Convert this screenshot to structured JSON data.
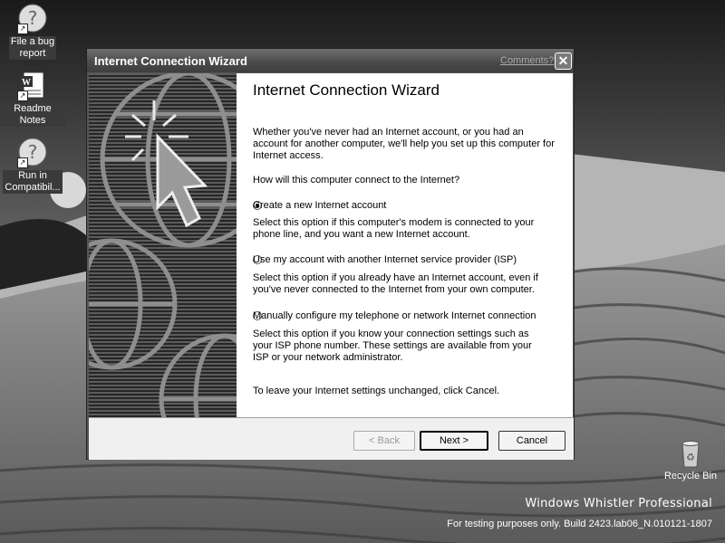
{
  "desktop": {
    "icons": [
      {
        "label_line1": "File a bug",
        "label_line2": "report"
      },
      {
        "label_line1": "Readme Notes",
        "label_line2": ""
      },
      {
        "label_line1": "Run in",
        "label_line2": "Compatibil..."
      }
    ],
    "recycle_bin_label": "Recycle Bin",
    "branding_title": "Windows Whistler Professional",
    "branding_build": "For testing purposes only. Build 2423.lab06_N.010121-1807"
  },
  "wizard": {
    "window_title": "Internet Connection Wizard",
    "comments_link": "Comments?",
    "close_glyph": "✕",
    "heading": "Internet Connection Wizard",
    "intro": "Whether you've never had an Internet account, or you had an account for another computer, we'll help you set up this computer for Internet access.",
    "question": "How will this computer connect to the Internet?",
    "options": [
      {
        "label": "Create a new Internet account",
        "description": "Select this option if this computer's modem is connected to your phone line, and you want a new Internet account.",
        "selected": true
      },
      {
        "label": "Use my account with another Internet service provider (ISP)",
        "description": "Select this option if you already have an Internet account, even if you've never connected to the Internet from your own computer.",
        "selected": false
      },
      {
        "label": "Manually configure my telephone or network Internet connection",
        "description": "Select this option if you know your connection settings such as your ISP phone number.  These settings are available from your ISP or your network administrator.",
        "selected": false
      }
    ],
    "footer_note": "To leave your Internet settings unchanged, click Cancel.",
    "buttons": {
      "back": "< Back",
      "next": "Next >",
      "cancel": "Cancel"
    }
  }
}
